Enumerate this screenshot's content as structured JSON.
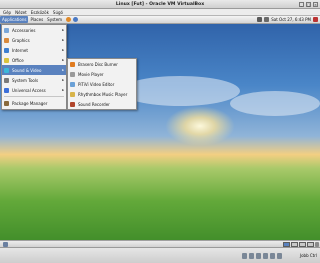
{
  "window": {
    "title": "Linux [Fut] - Oracle VM VirtualBox"
  },
  "vbox_menu": [
    "Gép",
    "Nézet",
    "Eszközök",
    "Súgó"
  ],
  "panel": {
    "menus": [
      "Applications",
      "Places",
      "System"
    ],
    "clock": "Sat Oct 27, 6:43 PM"
  },
  "apps_menu": [
    {
      "label": "Accessories",
      "icon_color": "#7aa7d9"
    },
    {
      "label": "Graphics",
      "icon_color": "#d98a3c"
    },
    {
      "label": "Internet",
      "icon_color": "#3d7fd0"
    },
    {
      "label": "Office",
      "icon_color": "#d9c23c"
    },
    {
      "label": "Sound & Video",
      "icon_color": "#3cb8d9"
    },
    {
      "label": "System Tools",
      "icon_color": "#7a7a7a"
    },
    {
      "label": "Universal Access",
      "icon_color": "#3c6fd9"
    },
    {
      "label": "Package Manager",
      "icon_color": "#8a6a3c"
    }
  ],
  "sound_submenu": [
    {
      "label": "Brasero Disc Burner",
      "icon_color": "#e07b1f"
    },
    {
      "label": "Movie Player",
      "icon_color": "#9a9a9a"
    },
    {
      "label": "PiTiVi Video Editor",
      "icon_color": "#6aa0d6"
    },
    {
      "label": "Rhythmbox Music Player",
      "icon_color": "#d8b44a"
    },
    {
      "label": "Sound Recorder",
      "icon_color": "#b0442a"
    }
  ],
  "status": {
    "host_key": "Jobb Ctrl"
  }
}
